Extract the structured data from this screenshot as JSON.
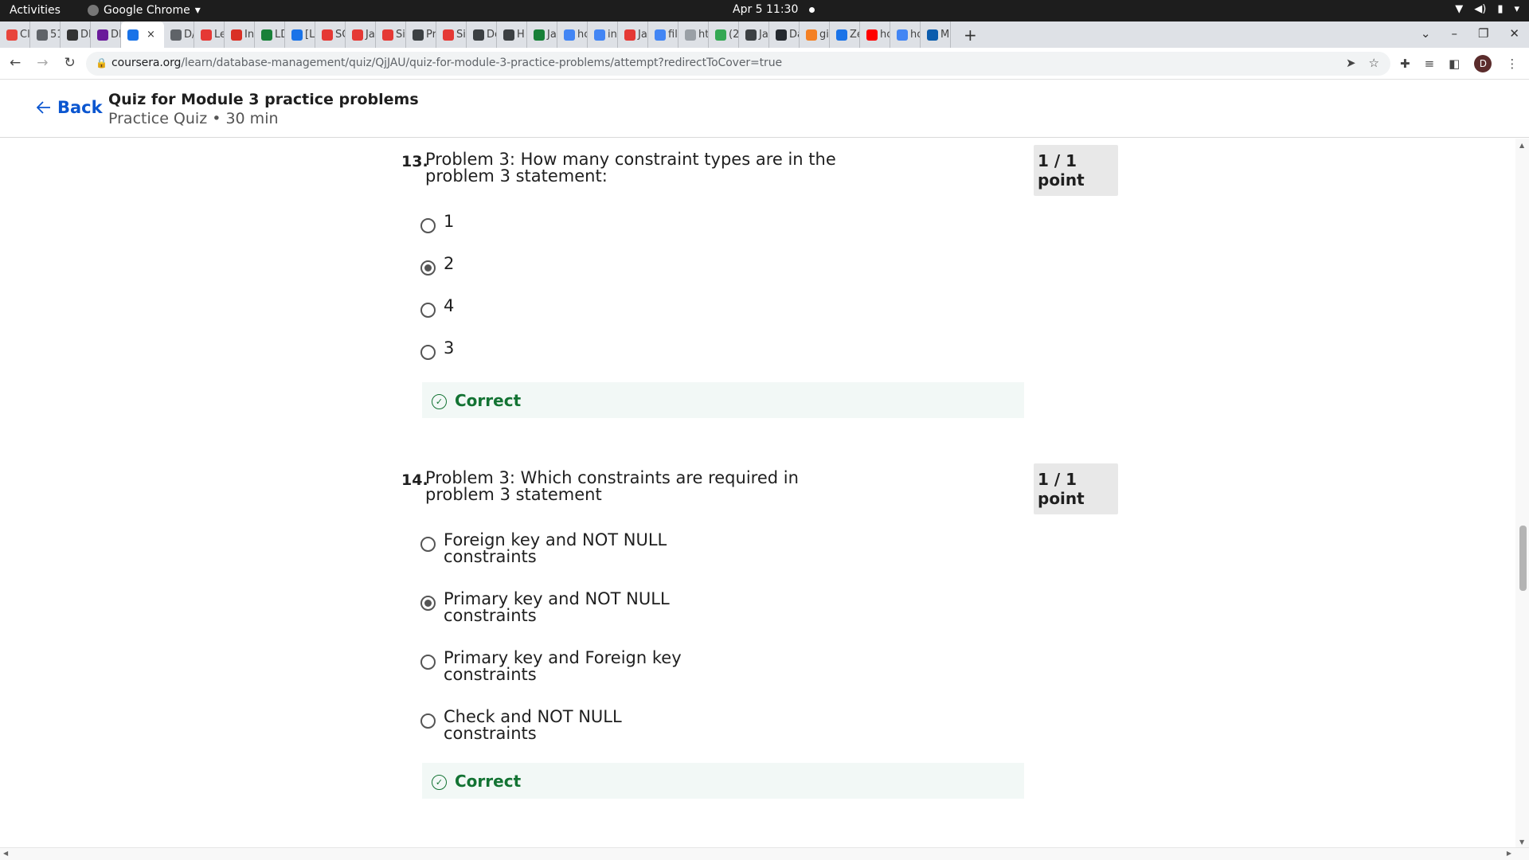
{
  "system": {
    "activities": "Activities",
    "app_name": "Google Chrome",
    "clock": "Apr 5  11:30"
  },
  "tabs": [
    {
      "label": "Cl",
      "color": "#e8453c"
    },
    {
      "label": "51",
      "color": "#5f6368"
    },
    {
      "label": "DI",
      "color": "#333333"
    },
    {
      "label": "DI",
      "color": "#6a1b9a"
    },
    {
      "label": "",
      "color": "#1a73e8",
      "active": true
    },
    {
      "label": "D/",
      "color": "#5f6368"
    },
    {
      "label": "Le",
      "color": "#e53935"
    },
    {
      "label": "In",
      "color": "#d93025"
    },
    {
      "label": "LD",
      "color": "#188038"
    },
    {
      "label": "[Li",
      "color": "#1a73e8"
    },
    {
      "label": "SC",
      "color": "#e53935"
    },
    {
      "label": "Ja",
      "color": "#e53935"
    },
    {
      "label": "Si",
      "color": "#e53935"
    },
    {
      "label": "Pr",
      "color": "#3c4043"
    },
    {
      "label": "Si",
      "color": "#e53935"
    },
    {
      "label": "De",
      "color": "#3c4043"
    },
    {
      "label": "H",
      "color": "#3c4043"
    },
    {
      "label": "Ja",
      "color": "#188038"
    },
    {
      "label": "hc",
      "color": "#4285f4"
    },
    {
      "label": "in",
      "color": "#4285f4"
    },
    {
      "label": "Ja",
      "color": "#e53935"
    },
    {
      "label": "fil",
      "color": "#4285f4"
    },
    {
      "label": "ht",
      "color": "#9aa0a6"
    },
    {
      "label": "(2",
      "color": "#34a853"
    },
    {
      "label": "Ja",
      "color": "#3c4043"
    },
    {
      "label": "Da",
      "color": "#24292f"
    },
    {
      "label": "gi",
      "color": "#f48024"
    },
    {
      "label": "Ze",
      "color": "#1a73e8"
    },
    {
      "label": "hc",
      "color": "#ff0000"
    },
    {
      "label": "hc",
      "color": "#4285f4"
    },
    {
      "label": "M",
      "color": "#0b5cad"
    }
  ],
  "active_tab_close": "×",
  "new_tab": "+",
  "address_bar": {
    "domain": "coursera.org",
    "path": "/learn/database-management/quiz/QjJAU/quiz-for-module-3-practice-problems/attempt?redirectToCover=true"
  },
  "profile_initial": "D",
  "header": {
    "back_label": "Back",
    "title": "Quiz for Module 3 practice problems",
    "subtitle": "Practice Quiz • 30 min"
  },
  "questions": [
    {
      "number": "13.",
      "text": "Problem 3: How many constraint types are in the problem 3 statement:",
      "points": "1 / 1 point",
      "options": [
        {
          "label": "1",
          "checked": false
        },
        {
          "label": "2",
          "checked": true
        },
        {
          "label": "4",
          "checked": false
        },
        {
          "label": "3",
          "checked": false
        }
      ],
      "feedback": "Correct"
    },
    {
      "number": "14.",
      "text": "Problem 3: Which constraints are required in problem 3 statement",
      "points": "1 / 1 point",
      "options": [
        {
          "label": "Foreign key and NOT NULL constraints",
          "checked": false
        },
        {
          "label": "Primary key and NOT NULL constraints",
          "checked": true
        },
        {
          "label": "Primary key and Foreign key constraints",
          "checked": false
        },
        {
          "label": "Check and NOT NULL constraints",
          "checked": false
        }
      ],
      "feedback": "Correct"
    }
  ],
  "colors": {
    "accent": "#0b56d0",
    "correct": "#137333",
    "feedback_bg": "#f2f8f6"
  }
}
